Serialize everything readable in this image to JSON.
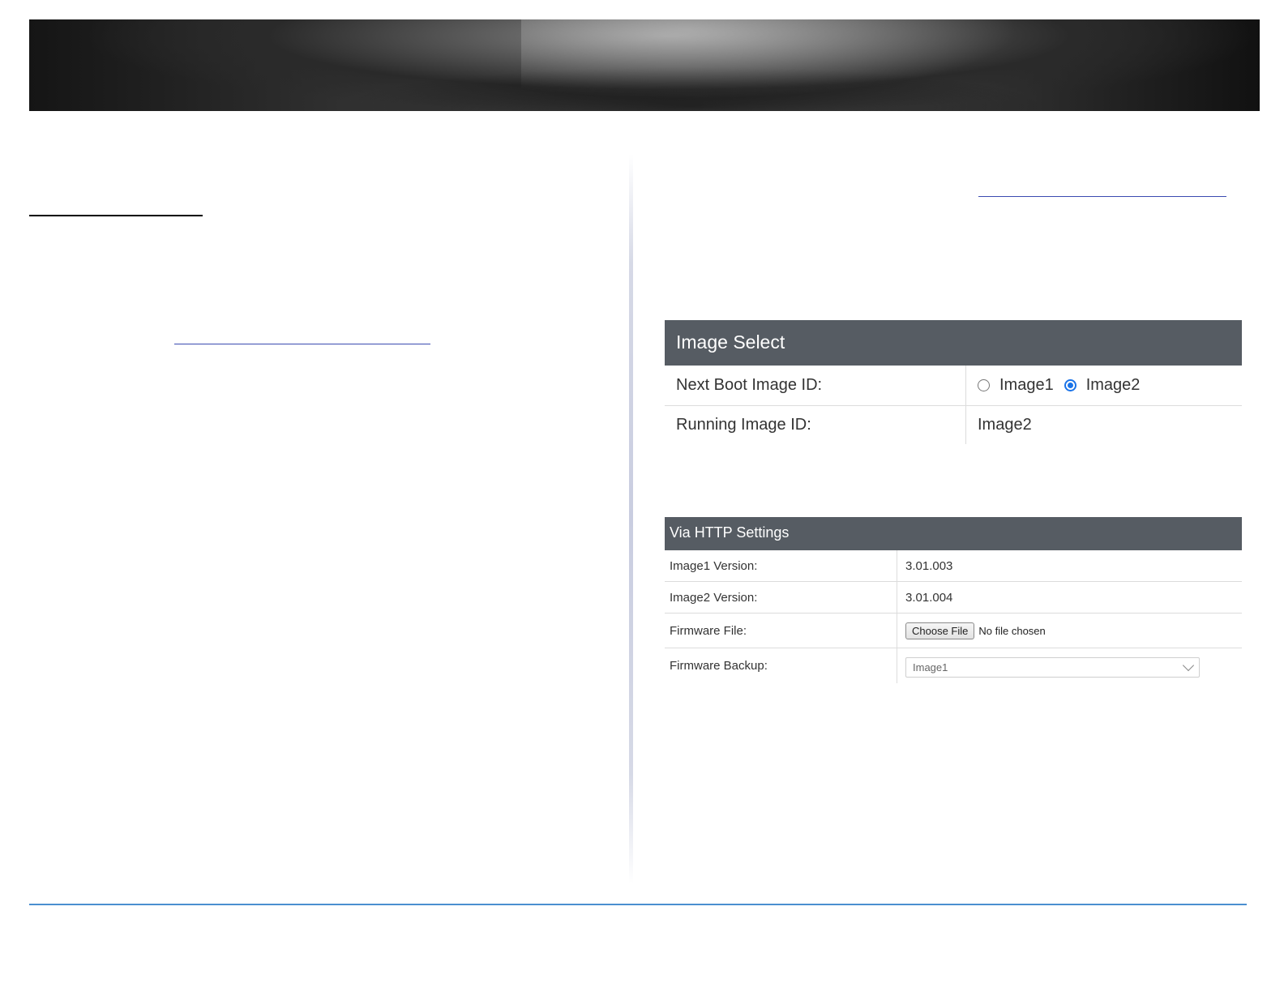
{
  "image_select": {
    "title": "Image Select",
    "rows": [
      {
        "label": "Next Boot Image ID:",
        "options": [
          {
            "label": "Image1",
            "selected": false
          },
          {
            "label": "Image2",
            "selected": true
          }
        ]
      },
      {
        "label": "Running Image ID:",
        "value": "Image2"
      }
    ]
  },
  "via_http": {
    "title": "Via HTTP Settings",
    "rows": [
      {
        "label": "Image1 Version:",
        "value": "3.01.003"
      },
      {
        "label": "Image2 Version:",
        "value": "3.01.004"
      },
      {
        "label": "Firmware File:",
        "button": "Choose File",
        "status": "No file chosen"
      },
      {
        "label": "Firmware Backup:",
        "selected": "Image1"
      }
    ]
  },
  "colors": {
    "panel_header": "#565c63",
    "radio_accent": "#1a73e8",
    "footer_line": "#4a8fd0"
  }
}
